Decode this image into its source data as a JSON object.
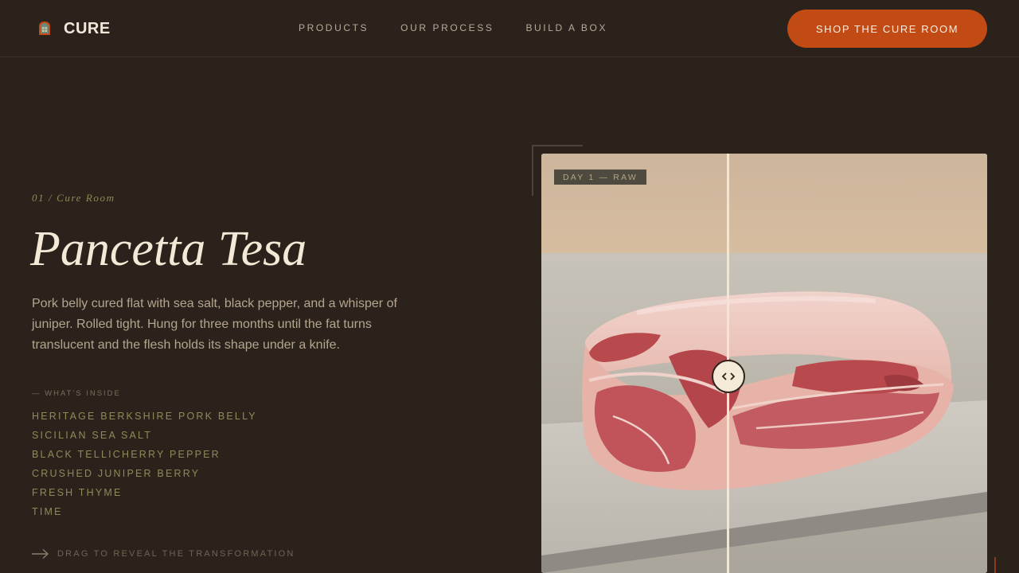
{
  "header": {
    "logo_text": "CURE",
    "nav": [
      "PRODUCTS",
      "OUR PROCESS",
      "BUILD A BOX"
    ],
    "cta_label": "SHOP THE CURE ROOM"
  },
  "hero": {
    "eyebrow": "01 / Cure Room",
    "title": "Pancetta Tesa",
    "description": "Pork belly cured flat with sea salt, black pepper, and a whisper of juniper. Rolled tight. Hung for three months until the fat turns translucent and the flesh holds its shape under a knife.",
    "inside_label": "— WHAT'S INSIDE",
    "ingredients": [
      "HERITAGE BERKSHIRE PORK BELLY",
      "SICILIAN SEA SALT",
      "BLACK TELLICHERRY PEPPER",
      "CRUSHED JUNIPER BERRY",
      "FRESH THYME",
      "TIME"
    ],
    "drag_hint": "DRAG TO REVEAL THE TRANSFORMATION"
  },
  "comparison": {
    "badge": "DAY 1 — RAW",
    "image_subject": "raw pork belly slab on stone board",
    "handle_icon": "left-right-arrows-icon"
  },
  "colors": {
    "background": "#2b231b",
    "accent": "#c24a14",
    "olive": "#8e8a58"
  }
}
